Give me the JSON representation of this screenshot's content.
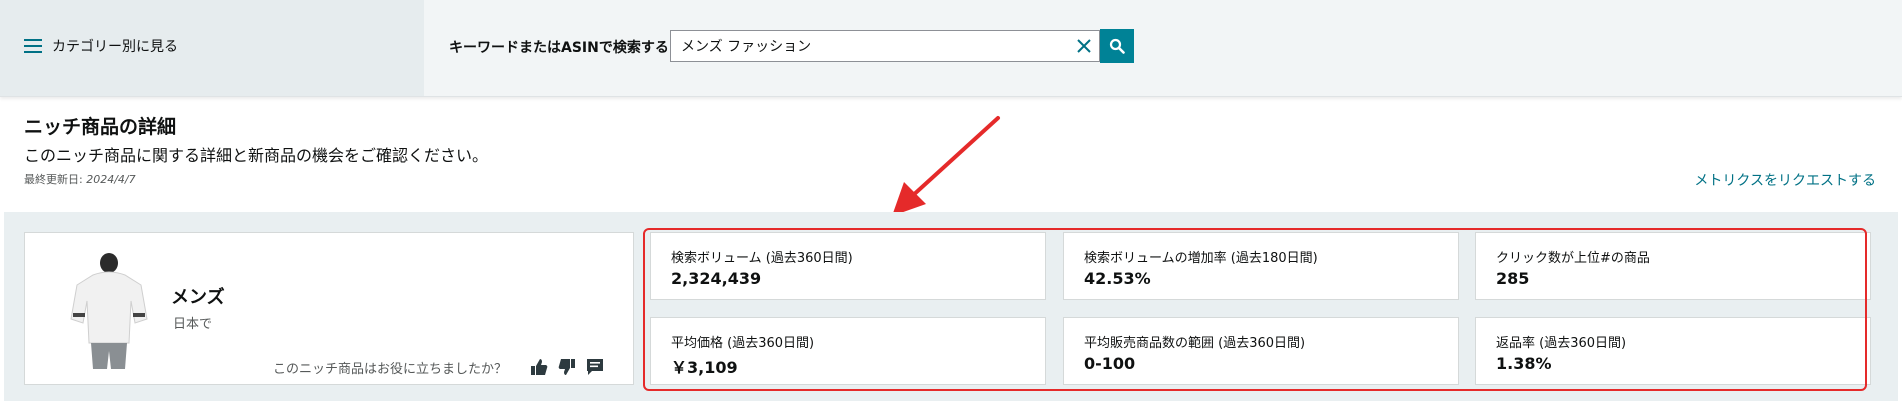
{
  "topbar": {
    "category_label": "カテゴリー別に見る",
    "search_label": "キーワードまたはASINで検索する",
    "search_value": "メンズ ファッション"
  },
  "header": {
    "title": "ニッチ商品の詳細",
    "subtitle": "このニッチ商品に関する詳細と新商品の機会をご確認ください。",
    "updated_prefix": "最終更新日:",
    "updated_date": "2024/4/7",
    "request_link": "メトリクスをリクエストする"
  },
  "product": {
    "name": "メンズ",
    "region": "日本で",
    "feedback_question": "このニッチ商品はお役に立ちましたか？"
  },
  "metrics": [
    {
      "label": "検索ボリューム (過去360日間)",
      "value": "2,324,439"
    },
    {
      "label": "検索ボリュームの増加率 (過去180日間)",
      "value": "42.53%"
    },
    {
      "label": "クリック数が上位#の商品",
      "value": "285"
    },
    {
      "label": "平均価格 (過去360日間)",
      "value": "￥3,109"
    },
    {
      "label": "平均販売商品数の範囲 (過去360日間)",
      "value": "0-100"
    },
    {
      "label": "返品率 (過去360日間)",
      "value": "1.38%"
    }
  ],
  "colors": {
    "accent": "#008296",
    "link": "#007185",
    "annotation": "#e52a2a"
  }
}
